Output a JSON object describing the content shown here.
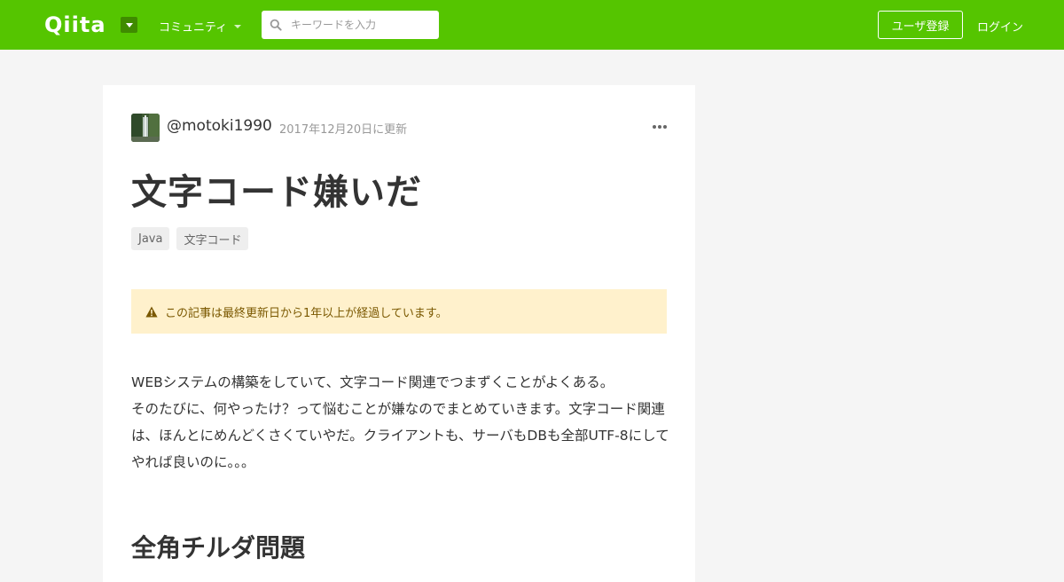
{
  "header": {
    "logo_text": "Qiita",
    "community_label": "コミュニティ",
    "search_placeholder": "キーワードを入力",
    "signup_label": "ユーザ登録",
    "login_label": "ログイン"
  },
  "article": {
    "author": "@motoki1990",
    "updated": "2017年12月20日に更新",
    "title": "文字コード嫌いだ",
    "tags": [
      "Java",
      "文字コード"
    ],
    "alert": "この記事は最終更新日から1年以上が経過しています。",
    "paragraph_lines": [
      "WEBシステムの構築をしていて、文字コード関連でつまずくことがよくある。",
      "そのたびに、何やったけ？って悩むことが嫌なのでまとめていきます。文字コード関連は、ほんとにめんどくさくていやだ。クライアントも、サーバもDBも全部UTF-8にしてやれば良いのに。。。"
    ],
    "subheading": "全角チルダ問題"
  },
  "colors": {
    "brand": "#55c500",
    "alert_bg": "#fff1cc"
  }
}
